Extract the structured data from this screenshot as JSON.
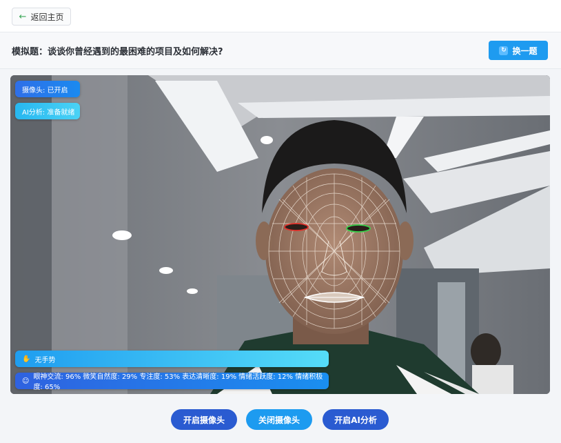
{
  "topbar": {
    "back_label": "返回主页"
  },
  "question_bar": {
    "question": "模拟题：谈谈你曾经遇到的最困难的项目及如何解决?",
    "swap_label": "换一题"
  },
  "video": {
    "camera_status": "摄像头: 已开启",
    "ai_status": "AI分析: 准备就绪",
    "gesture_status": "无手势",
    "metrics": "眼神交流: 96% 微笑自然度: 29% 专注度: 53% 表达清晰度: 19% 情绪活跃度: 12% 情绪积极度: 65%"
  },
  "controls": {
    "open_camera": "开启摄像头",
    "close_camera": "关闭摄像头",
    "start_ai": "开启AI分析"
  }
}
